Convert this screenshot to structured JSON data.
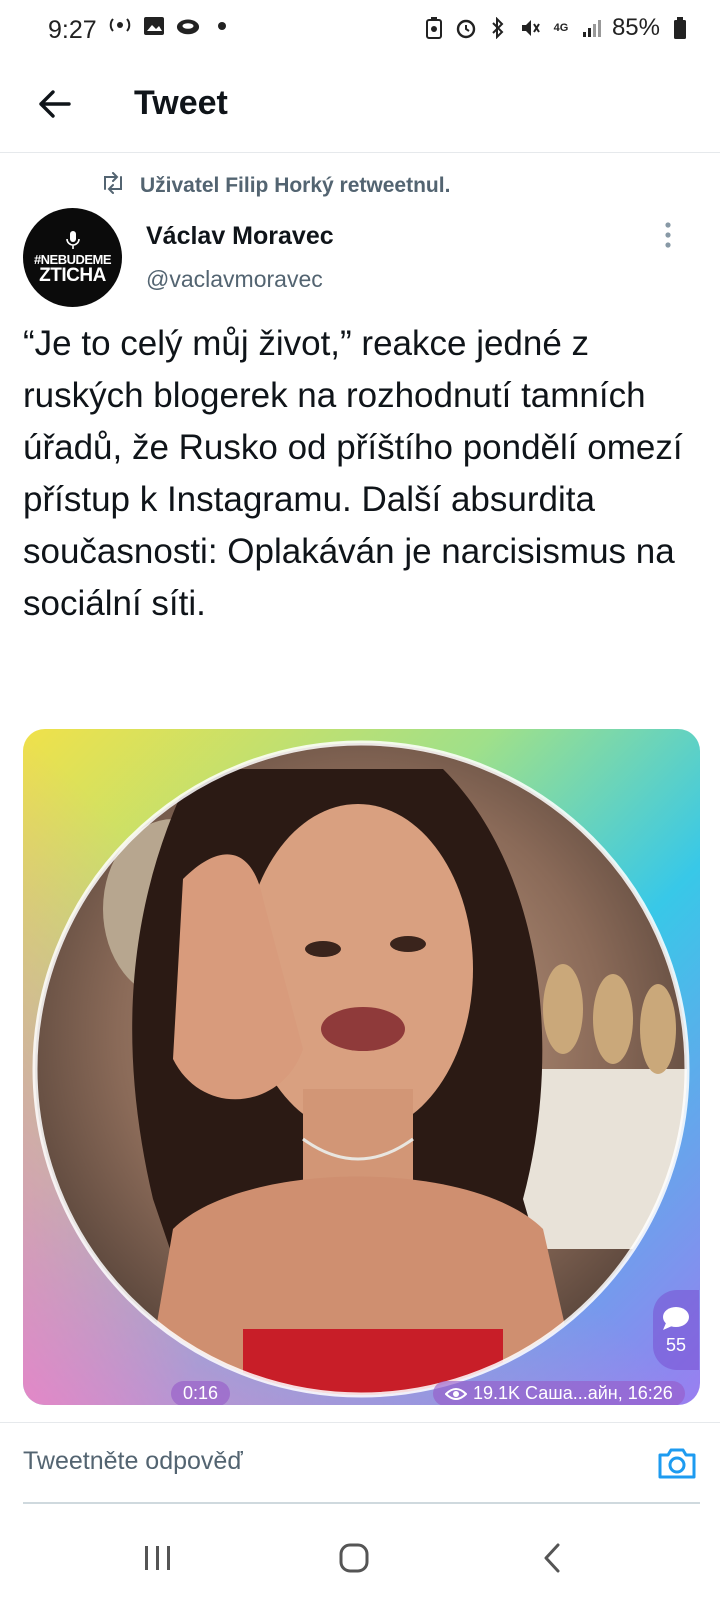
{
  "status_bar": {
    "time": "9:27",
    "network": "4G",
    "battery": "85%"
  },
  "header": {
    "title": "Tweet"
  },
  "tweet": {
    "retweet_label": "Uživatel Filip Horký retweetnul.",
    "author": {
      "avatar_line1": "#NEBUDEME",
      "avatar_line2": "ZTICHA",
      "name": "Václav Moravec",
      "handle": "@vaclavmoravec"
    },
    "text": "“Je to celý můj život,” reakce jedné z ruských blogerek na rozhodnutí tamních úřadů, že Rusko od příštího pondělí omezí přístup k Instagramu. Další absurdita současnosti: Oplakáván je narcisismus na sociální síti.",
    "media": {
      "duration": "0:16",
      "meta": "19.1K Саша...айн, 16:26",
      "comment_count": "55"
    }
  },
  "reply": {
    "placeholder": "Tweetněte odpověď"
  },
  "colors": {
    "text": "#0f1419",
    "secondary": "#536471",
    "accent": "#1d9bf0"
  },
  "icons": [
    "back-arrow-icon",
    "retweet-icon",
    "more-icon",
    "camera-icon",
    "eye-icon",
    "comment-icon"
  ]
}
